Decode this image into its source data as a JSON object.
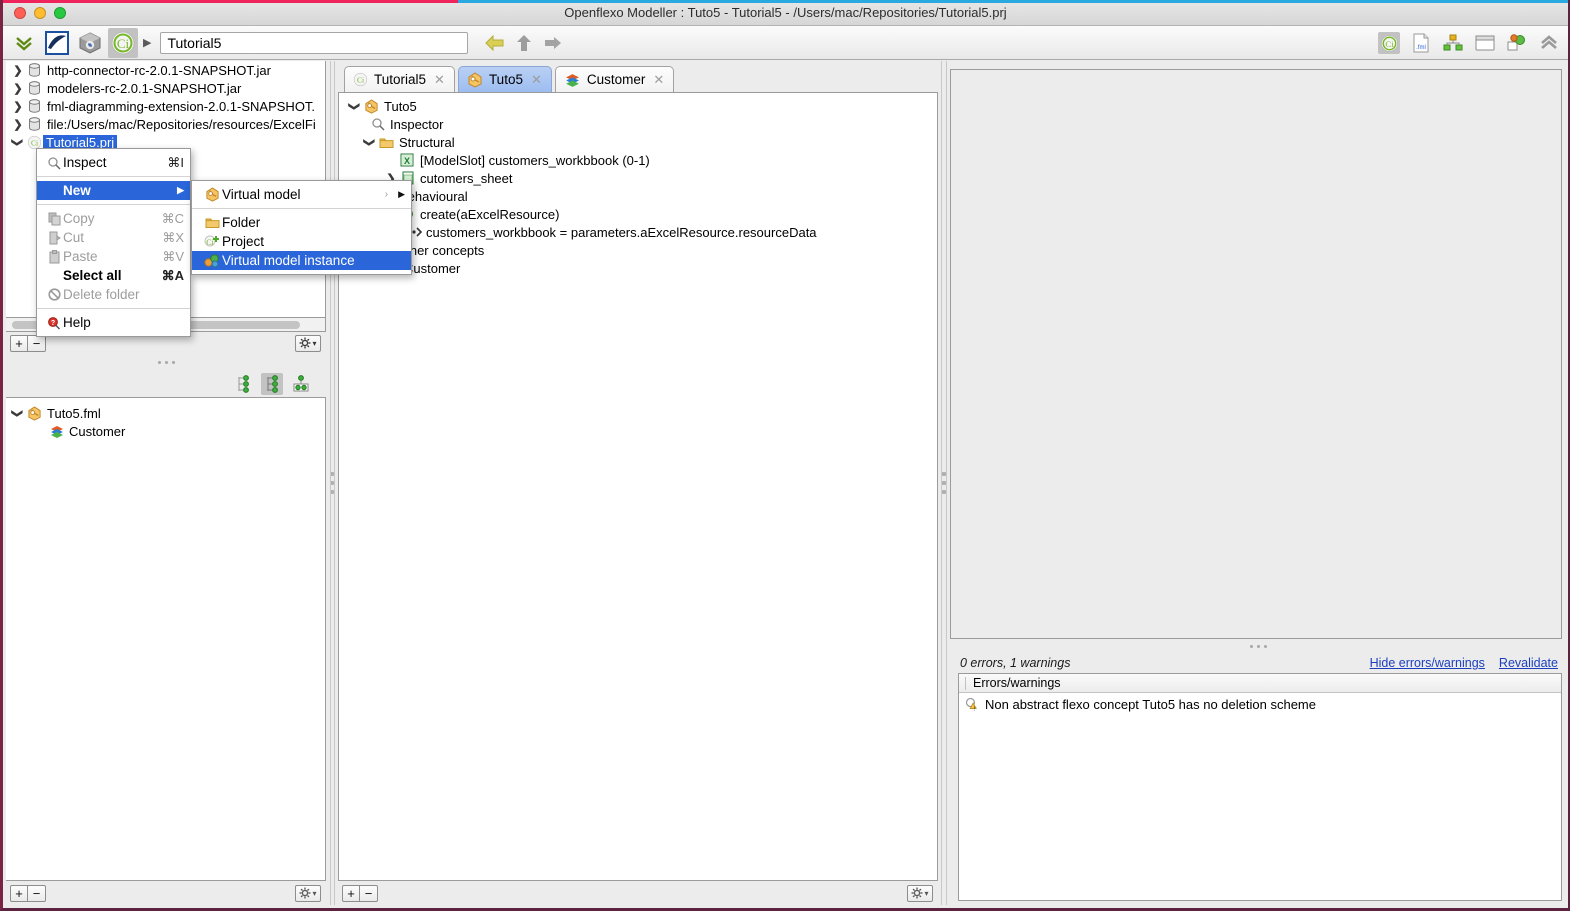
{
  "window": {
    "title": "Openflexo Modeller : Tuto5 - Tutorial5 - /Users/mac/Repositories/Tutorial5.prj",
    "accent_pink": "#f0245c",
    "accent_blue": "#2aa8e0",
    "selection_blue": "#2a66d9"
  },
  "toolbar": {
    "icons": [
      "chevrons-down-icon",
      "openflexo-logo-icon",
      "cube-icon",
      "openflexo-project-icon"
    ],
    "path_caret": "▶",
    "url_value": "Tutorial5",
    "url_placeholder": "",
    "nav": [
      "back-arrow-icon",
      "up-arrow-icon",
      "forward-arrow-icon"
    ],
    "right_icons": [
      "project-perspective-icon",
      "fml-file-icon",
      "hierarchy-icon",
      "window-icon",
      "diagram-icon",
      "collapse-all-icon"
    ]
  },
  "resource_tree": {
    "items": [
      {
        "label": "http-connector-rc-2.0.1-SNAPSHOT.jar",
        "icon": "database-icon",
        "expander": "collapsed",
        "selected": false
      },
      {
        "label": "modelers-rc-2.0.1-SNAPSHOT.jar",
        "icon": "database-icon",
        "expander": "collapsed",
        "selected": false
      },
      {
        "label": "fml-diagramming-extension-2.0.1-SNAPSHOT.",
        "icon": "database-icon",
        "expander": "collapsed",
        "selected": false
      },
      {
        "label": "file:/Users/mac/Repositories/resources/ExcelFi",
        "icon": "database-icon",
        "expander": "collapsed",
        "selected": false
      },
      {
        "label": "Tutorial5.prj",
        "icon": "openflexo-project-icon",
        "expander": "expanded",
        "selected": true
      }
    ]
  },
  "context_menu": {
    "items": [
      {
        "label": "Inspect",
        "accel": "⌘I",
        "icon": "magnifier-icon",
        "state": "normal"
      },
      {
        "type": "separator"
      },
      {
        "label": "New",
        "accel": "",
        "icon": "",
        "state": "highlighted",
        "submenu_arrow": "▶"
      },
      {
        "type": "separator"
      },
      {
        "label": "Copy",
        "accel": "⌘C",
        "icon": "copy-icon",
        "state": "disabled"
      },
      {
        "label": "Cut",
        "accel": "⌘X",
        "icon": "cut-icon",
        "state": "disabled"
      },
      {
        "label": "Paste",
        "accel": "⌘V",
        "icon": "paste-icon",
        "state": "disabled"
      },
      {
        "label": "Select all",
        "accel": "⌘A",
        "icon": "",
        "state": "bold"
      },
      {
        "label": "Delete folder",
        "accel": "",
        "icon": "forbidden-icon",
        "state": "disabled"
      },
      {
        "type": "separator"
      },
      {
        "label": "Help",
        "accel": "",
        "icon": "help-icon",
        "state": "normal"
      }
    ]
  },
  "context_submenu": {
    "items": [
      {
        "label": "Virtual model",
        "icon": "virtual-model-icon",
        "state": "normal",
        "submenu_arrow": "▶",
        "expander": "›"
      },
      {
        "type": "separator"
      },
      {
        "label": "Folder",
        "icon": "folder-icon",
        "state": "normal"
      },
      {
        "label": "Project",
        "icon": "openflexo-project-new-icon",
        "state": "normal"
      },
      {
        "label": "Virtual model instance",
        "icon": "virtual-model-instance-icon",
        "state": "selected"
      }
    ]
  },
  "tabs": [
    {
      "label": "Tutorial5",
      "icon": "openflexo-project-icon",
      "active": false,
      "close": "✕"
    },
    {
      "label": "Tuto5",
      "icon": "virtual-model-icon",
      "active": true,
      "close": "✕"
    },
    {
      "label": "Customer",
      "icon": "flexo-concept-icon",
      "active": false,
      "close": "✕"
    }
  ],
  "model_tree": {
    "items": [
      {
        "label": "Tuto5",
        "icon": "virtual-model-icon",
        "expander": "expanded",
        "indent": 0
      },
      {
        "label": "Inspector",
        "icon": "magnifier-icon",
        "expander": "none",
        "indent": 1
      },
      {
        "label": "Structural",
        "icon": "folder-icon",
        "expander": "expanded",
        "indent": 1
      },
      {
        "label": "[ModelSlot] customers_workbbook (0-1)",
        "icon": "excel-icon",
        "expander": "none",
        "indent": 2
      },
      {
        "label": "cutomers_sheet",
        "icon": "excel-sheet-icon",
        "expander": "collapsed",
        "indent": 2
      },
      {
        "label": "Behavioural",
        "icon": "folder-icon",
        "expander": "expanded",
        "indent": 1
      },
      {
        "label": "create(aExcelResource)",
        "icon": "creation-scheme-icon",
        "expander": "expanded",
        "indent": 2
      },
      {
        "label": "customers_workbbook = parameters.aExcelResource.resourceData",
        "icon": "assignment-icon",
        "expander": "none",
        "indent": 3
      },
      {
        "label": "Inner concepts",
        "icon": "folder-icon",
        "expander": "expanded",
        "indent": 1
      },
      {
        "label": "Customer",
        "icon": "flexo-concept-icon",
        "expander": "none",
        "indent": 2
      }
    ]
  },
  "fml_panel": {
    "view_icons": [
      "list-view-icon",
      "tree-view-icon",
      "graph-view-icon"
    ],
    "selected_view": "tree-view-icon",
    "tree": [
      {
        "label": "Tuto5.fml",
        "icon": "virtual-model-icon",
        "expander": "expanded",
        "indent": 0
      },
      {
        "label": "Customer",
        "icon": "flexo-concept-icon",
        "expander": "none",
        "indent": 1
      }
    ]
  },
  "panel_toolbars": {
    "add_label": "+",
    "remove_label": "−",
    "gear_label": "gear-icon",
    "gear_caret": "▾"
  },
  "errors_panel": {
    "summary": "0 errors, 1 warnings",
    "hide_link": "Hide errors/warnings",
    "revalidate_link": "Revalidate",
    "column_header": "Errors/warnings",
    "rows": [
      {
        "icon": "warning-icon",
        "message": "Non abstract flexo concept Tuto5 has no deletion scheme"
      }
    ]
  }
}
